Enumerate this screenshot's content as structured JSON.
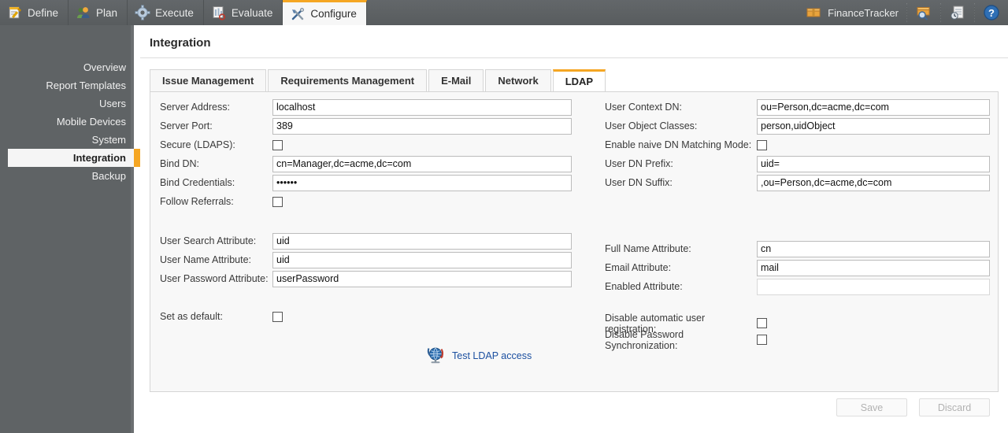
{
  "topnav": {
    "items": [
      {
        "label": "Define",
        "icon": "notepad-pencil-icon",
        "active": false
      },
      {
        "label": "Plan",
        "icon": "users-group-icon",
        "active": false
      },
      {
        "label": "Execute",
        "icon": "gear-icon",
        "active": false
      },
      {
        "label": "Evaluate",
        "icon": "report-chart-icon",
        "active": false
      },
      {
        "label": "Configure",
        "icon": "tools-wrench-screwdriver-icon",
        "active": true
      }
    ],
    "project": {
      "label": "FinanceTracker",
      "icon": "project-box-icon"
    },
    "tools": [
      {
        "icon": "box-search-icon"
      },
      {
        "icon": "document-clock-icon"
      },
      {
        "icon": "help-question-icon"
      }
    ]
  },
  "sidebar": {
    "items": [
      {
        "label": "Overview",
        "active": false
      },
      {
        "label": "Report Templates",
        "active": false
      },
      {
        "label": "Users",
        "active": false
      },
      {
        "label": "Mobile Devices",
        "active": false
      },
      {
        "label": "System",
        "active": false
      },
      {
        "label": "Integration",
        "active": true
      },
      {
        "label": "Backup",
        "active": false
      }
    ]
  },
  "page": {
    "title": "Integration"
  },
  "tabs": [
    {
      "label": "Issue Management",
      "active": false
    },
    {
      "label": "Requirements Management",
      "active": false
    },
    {
      "label": "E-Mail",
      "active": false
    },
    {
      "label": "Network",
      "active": false
    },
    {
      "label": "LDAP",
      "active": true
    }
  ],
  "form": {
    "left_group1": [
      {
        "label": "Server Address:",
        "type": "text",
        "value": "localhost"
      },
      {
        "label": "Server Port:",
        "type": "text",
        "value": "389"
      },
      {
        "label": "Secure (LDAPS):",
        "type": "checkbox",
        "checked": false
      },
      {
        "label": "Bind DN:",
        "type": "text",
        "value": "cn=Manager,dc=acme,dc=com"
      },
      {
        "label": "Bind Credentials:",
        "type": "password",
        "value": "••••••"
      },
      {
        "label": "Follow Referrals:",
        "type": "checkbox",
        "checked": false
      }
    ],
    "left_group2": [
      {
        "label": "User Search Attribute:",
        "type": "text",
        "value": "uid"
      },
      {
        "label": "User Name Attribute:",
        "type": "text",
        "value": "uid"
      },
      {
        "label": "User Password Attribute:",
        "type": "text",
        "value": "userPassword"
      }
    ],
    "left_group3": [
      {
        "label": "Set as default:",
        "type": "checkbox",
        "checked": false
      }
    ],
    "right_group1": [
      {
        "label": "User Context DN:",
        "type": "text",
        "value": "ou=Person,dc=acme,dc=com"
      },
      {
        "label": "User Object Classes:",
        "type": "text",
        "value": "person,uidObject"
      },
      {
        "label": "Enable naive DN Matching Mode:",
        "type": "checkbox",
        "checked": false
      },
      {
        "label": "User DN Prefix:",
        "type": "text",
        "value": "uid="
      },
      {
        "label": "User DN Suffix:",
        "type": "text",
        "value": ",ou=Person,dc=acme,dc=com"
      }
    ],
    "right_group2": [
      {
        "label": "Full Name Attribute:",
        "type": "text",
        "value": "cn"
      },
      {
        "label": "Email Attribute:",
        "type": "text",
        "value": "mail"
      },
      {
        "label": "Enabled Attribute:",
        "type": "text",
        "value": "",
        "dim": true
      }
    ],
    "right_group3": [
      {
        "label": "Disable automatic user registration:",
        "type": "checkbox",
        "checked": false
      },
      {
        "label": "Disable Password Synchronization:",
        "type": "checkbox",
        "checked": false
      }
    ],
    "test_link": {
      "label": "Test LDAP access",
      "icon": "globe-network-icon"
    }
  },
  "footer": {
    "save_label": "Save",
    "discard_label": "Discard",
    "save_enabled": false,
    "discard_enabled": false
  },
  "colors": {
    "accent": "#f5a623",
    "topbar": "#5f6365",
    "sidebar": "#5f6365",
    "panel": "#f8f8f8",
    "link": "#1b4fa0"
  }
}
